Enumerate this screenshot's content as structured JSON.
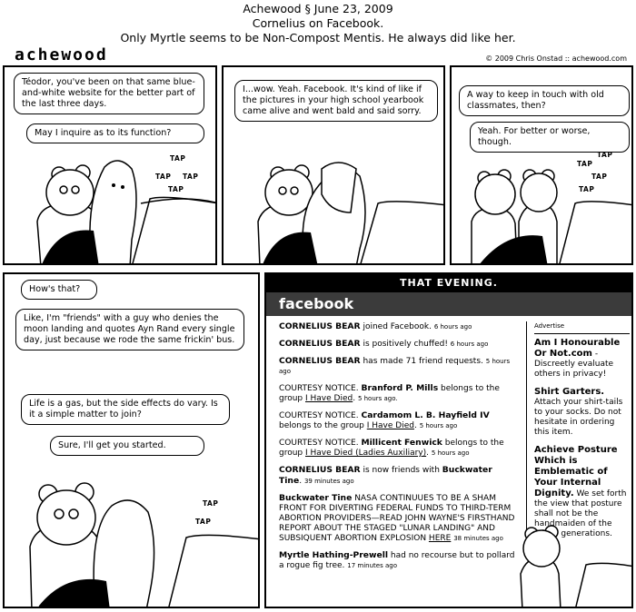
{
  "header": {
    "line1": "Achewood § June 23, 2009",
    "line2": "Cornelius on Facebook.",
    "line3": "Only Myrtle seems to be Non-Compost Mentis. He always did like her."
  },
  "logo": "achewood",
  "copyright": "© 2009 Chris Onstad :: achewood.com",
  "panel1": {
    "b1": "Téodor, you've been on that same blue-and-white website for the better part of the last three days.",
    "b2": "May I inquire as to its function?",
    "taps": [
      "TAP",
      "TAP",
      "TAP",
      "TAP"
    ]
  },
  "panel2": {
    "b1": "I...wow. Yeah. Facebook. It's kind of like if the pictures in your high school yearbook came alive and went bald and said sorry."
  },
  "panel3": {
    "b1": "A way to keep in touch with old classmates, then?",
    "b2": "Yeah. For better or worse, though.",
    "taps": [
      "TAP",
      "TAP",
      "TAP",
      "TAP"
    ]
  },
  "panel4": {
    "b1": "How's that?",
    "b2": "Like, I'm \"friends\" with a guy who denies the moon landing and quotes Ayn Rand every single day, just because we rode the same frickin' bus.",
    "b3": "Life is a gas, but the side effects do vary. Is it a simple matter to join?",
    "b4": "Sure, I'll get you started.",
    "taps": [
      "TAP",
      "TAP"
    ]
  },
  "panel5": {
    "banner": "THAT EVENING.",
    "fb_logo": "facebook",
    "feed": [
      {
        "name": "CORNELIUS BEAR",
        "text": " joined Facebook. ",
        "time": "6 hours ago"
      },
      {
        "name": "CORNELIUS BEAR",
        "text": " is positively chuffed! ",
        "time": "6 hours ago"
      },
      {
        "name": "CORNELIUS BEAR",
        "text": " has made 71 friend requests. ",
        "time": "5 hours ago"
      },
      {
        "pre": "COURTESY NOTICE. ",
        "name": "Branford P. Mills",
        "text": " belongs to the group ",
        "link": "I Have Died",
        "post": ". ",
        "time": "5 hours ago."
      },
      {
        "pre": "COURTESY NOTICE. ",
        "name": "Cardamom L. B. Hayfield IV",
        "text": " belongs to the group ",
        "link": "I Have Died",
        "post": ". ",
        "time": "5 hours ago"
      },
      {
        "pre": "COURTESY NOTICE. ",
        "name": "Millicent Fenwick",
        "text": " belongs to the group ",
        "link": "I Have Died (Ladies Auxiliary)",
        "post": ". ",
        "time": "5 hours ago"
      },
      {
        "name": "CORNELIUS BEAR",
        "text": " is now friends with ",
        "name2": "Buckwater Tine",
        "post": ". ",
        "time": "39 minutes ago"
      },
      {
        "name": "Buckwater Tine",
        "text": " NASA CONTINUUES TO BE A SHAM FRONT FOR DIVERTING FEDERAL FUNDS TO THIRD-TERM ABORTION PROVIDERS—READ JOHN WAYNE'S FIRSTHAND REPORT ABOUT THE STAGED \"LUNAR LANDING\" AND SUBSIQUENT ABORTION EXPLOSION ",
        "link": "HERE",
        "post": " ",
        "time": "38 minutes ago"
      },
      {
        "name": "Myrtle Hathing-Prewell",
        "text": " had no recourse but to pollard a rogue fig tree. ",
        "time": "17 minutes ago"
      }
    ],
    "ads_label": "Advertise",
    "ads": [
      {
        "title": "Am I Honourable Or Not.com",
        "body": " - Discreetly evaluate others in privacy!"
      },
      {
        "title": "Shirt Garters.",
        "body": " Attach your shirt-tails to your socks. Do not hesitate in ordering this item."
      },
      {
        "title": "Achieve Posture Which is Emblematic of Your Internal Dignity.",
        "body": " We set forth the view that posture shall not be the handmaiden of the fallow generations."
      }
    ]
  }
}
